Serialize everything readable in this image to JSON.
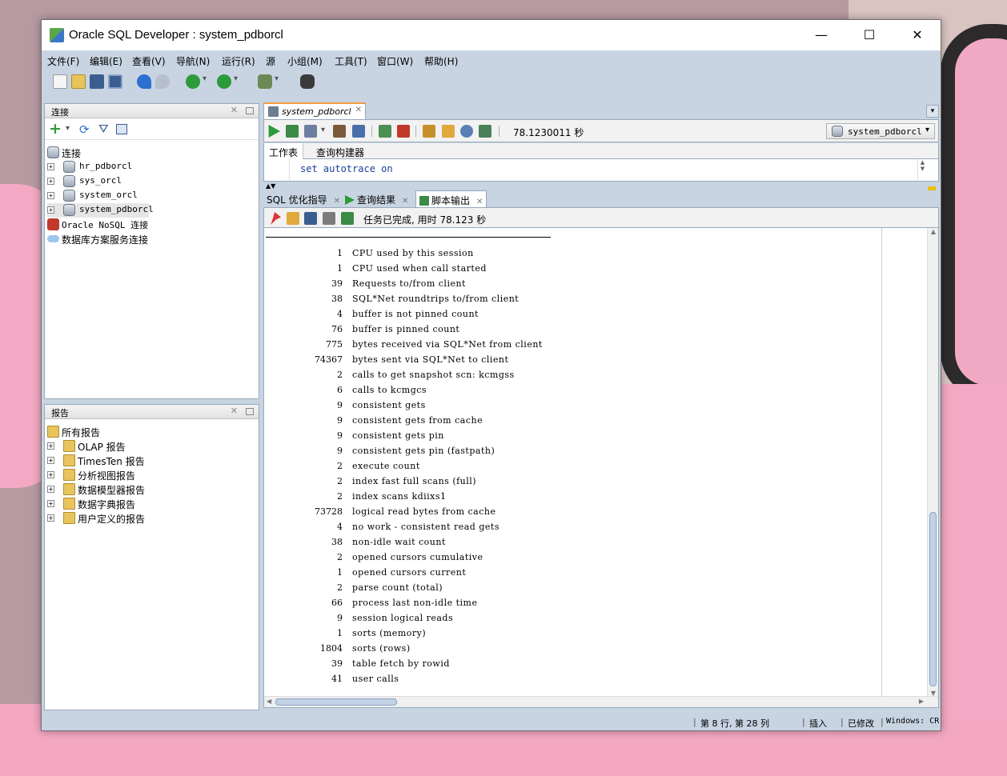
{
  "window": {
    "title": "Oracle SQL Developer : system_pdborcl",
    "controls": {
      "min": "—",
      "max": "☐",
      "close": "✕"
    }
  },
  "menu": [
    "文件(F)",
    "编辑(E)",
    "查看(V)",
    "导航(N)",
    "运行(R)",
    "源",
    "小组(M)",
    "工具(T)",
    "窗口(W)",
    "帮助(H)"
  ],
  "connections_panel": {
    "title": "连接",
    "root": "连接",
    "items": [
      "hr_pdborcl",
      "sys_orcl",
      "system_orcl",
      "system_pdborcl"
    ],
    "nosql": "Oracle NoSQL 连接",
    "cloud": "数据库方案服务连接",
    "expand_glyph": "+"
  },
  "reports_panel": {
    "title": "报告",
    "root": "所有报告",
    "items": [
      "OLAP 报告",
      "TimesTen 报告",
      "分析视图报告",
      "数据模型器报告",
      "数据字典报告",
      "用户定义的报告"
    ]
  },
  "editor": {
    "tab_label": "system_pdborcl",
    "elapsed": "78.1230011 秒",
    "connection": "system_pdborcl",
    "subtabs": [
      "工作表",
      "查询构建器"
    ],
    "sql": "set autotrace on",
    "output_tabs": [
      "SQL 优化指导",
      "查询结果",
      "脚本输出"
    ],
    "output_status": "任务已完成, 用时 78.123 秒"
  },
  "stats": [
    {
      "value": "1",
      "name": "CPU used by this session"
    },
    {
      "value": "1",
      "name": "CPU used when call started"
    },
    {
      "value": "39",
      "name": "Requests to/from client"
    },
    {
      "value": "38",
      "name": "SQL*Net roundtrips to/from client"
    },
    {
      "value": "4",
      "name": "buffer is not pinned count"
    },
    {
      "value": "76",
      "name": "buffer is pinned count"
    },
    {
      "value": "775",
      "name": "bytes received via SQL*Net from client"
    },
    {
      "value": "74367",
      "name": "bytes sent via SQL*Net to client"
    },
    {
      "value": "2",
      "name": "calls to get snapshot scn: kcmgss"
    },
    {
      "value": "6",
      "name": "calls to kcmgcs"
    },
    {
      "value": "9",
      "name": "consistent gets"
    },
    {
      "value": "9",
      "name": "consistent gets from cache"
    },
    {
      "value": "9",
      "name": "consistent gets pin"
    },
    {
      "value": "9",
      "name": "consistent gets pin (fastpath)"
    },
    {
      "value": "2",
      "name": "execute count"
    },
    {
      "value": "2",
      "name": "index fast full scans (full)"
    },
    {
      "value": "2",
      "name": "index scans kdiixs1"
    },
    {
      "value": "73728",
      "name": "logical read bytes from cache"
    },
    {
      "value": "4",
      "name": "no work - consistent read gets"
    },
    {
      "value": "38",
      "name": "non-idle wait count"
    },
    {
      "value": "2",
      "name": "opened cursors cumulative"
    },
    {
      "value": "1",
      "name": "opened cursors current"
    },
    {
      "value": "2",
      "name": "parse count (total)"
    },
    {
      "value": "66",
      "name": "process last non-idle time"
    },
    {
      "value": "9",
      "name": "session logical reads"
    },
    {
      "value": "1",
      "name": "sorts (memory)"
    },
    {
      "value": "1804",
      "name": "sorts (rows)"
    },
    {
      "value": "39",
      "name": "table fetch by rowid"
    },
    {
      "value": "41",
      "name": "user calls"
    }
  ],
  "statusbar": {
    "position": "第 8 行, 第 28 列",
    "mode": "插入",
    "modified": "已修改",
    "eol": "Windows: CR"
  },
  "colors": {
    "chrome": "#c8d4e2",
    "tab_accent": "#f39c3c",
    "sql_text": "#1b3f9a"
  }
}
